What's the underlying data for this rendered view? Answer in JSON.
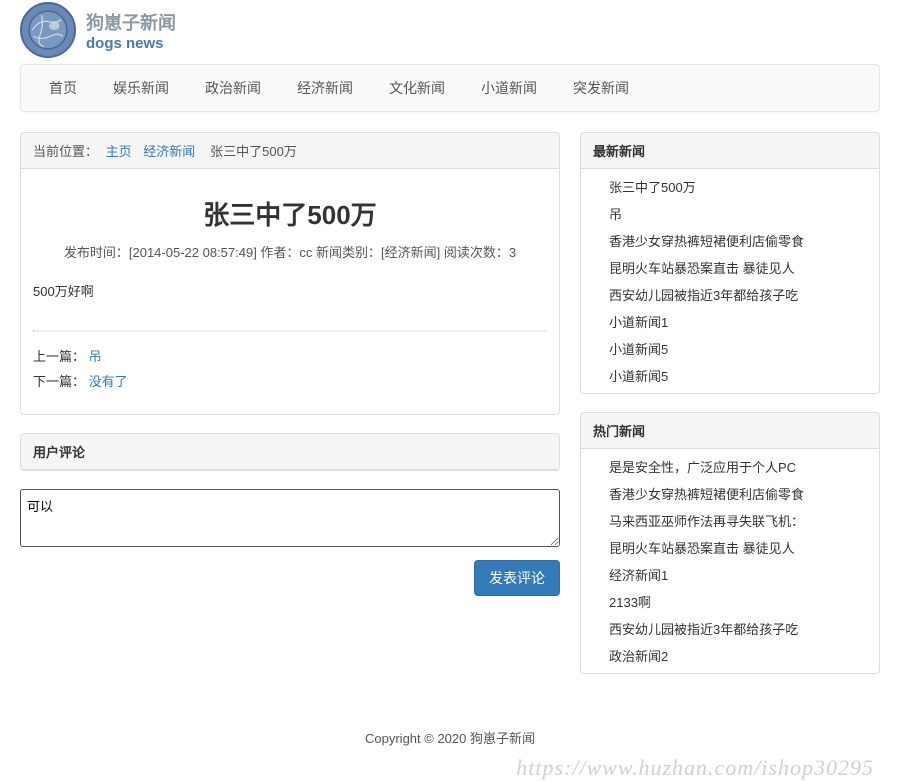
{
  "site": {
    "title_cn": "狗崽子新闻",
    "title_en": "dogs news"
  },
  "nav": {
    "items": [
      "首页",
      "娱乐新闻",
      "政治新闻",
      "经济新闻",
      "文化新闻",
      "小道新闻",
      "突发新闻"
    ]
  },
  "breadcrumb": {
    "label": "当前位置：",
    "home": "主页",
    "category": "经济新闻",
    "current": "张三中了500万"
  },
  "article": {
    "title": "张三中了500万",
    "meta": "发布时间：[2014-05-22 08:57:49]   作者：cc  新闻类别：[经济新闻]  阅读次数：3",
    "body": "500万好啊",
    "prev_label": "上一篇：",
    "prev_title": "吊",
    "next_label": "下一篇：",
    "next_title": "没有了"
  },
  "comments": {
    "heading": "用户评论",
    "input_value": "可以",
    "submit_label": "发表评论"
  },
  "sidebar": {
    "latest_heading": "最新新闻",
    "latest": [
      "张三中了500万",
      "吊",
      "香港少女穿热裤短裙便利店偷零食",
      "昆明火车站暴恐案直击 暴徒见人",
      "西安幼儿园被指近3年都给孩子吃",
      "小道新闻1",
      "小道新闻5",
      "小道新闻5"
    ],
    "hot_heading": "热门新闻",
    "hot": [
      "是是安全性，广泛应用于个人PC",
      "香港少女穿热裤短裙便利店偷零食",
      "马来西亚巫师作法再寻失联飞机：",
      "昆明火车站暴恐案直击 暴徒见人",
      "经济新闻1",
      "2133啊",
      "西安幼儿园被指近3年都给孩子吃",
      "政治新闻2"
    ]
  },
  "footer": {
    "copyright": "Copyright © 2020 狗崽子新闻"
  },
  "watermark": "https://www.huzhan.com/ishop30295"
}
